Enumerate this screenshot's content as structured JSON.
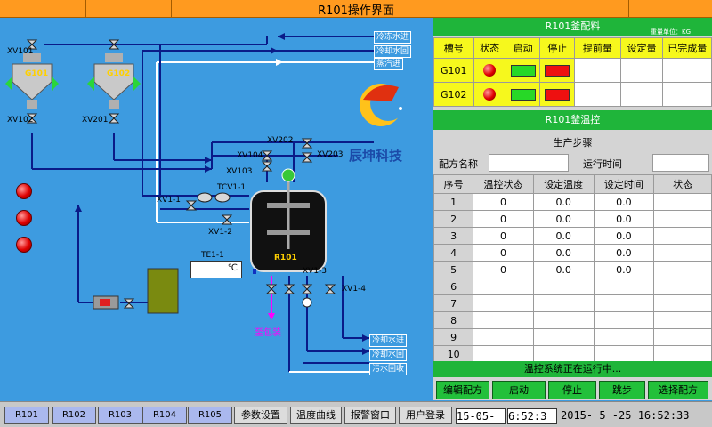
{
  "window": {
    "title": "R101操作界面"
  },
  "schematic": {
    "tanks": [
      {
        "label": "G101"
      },
      {
        "label": "G102"
      }
    ],
    "reactor": {
      "label": "R101"
    },
    "valves": {
      "xv101": "XV101",
      "xv102": "XV102",
      "xv201": "XV201",
      "xv202": "XV202",
      "xv203": "XV203",
      "xv103": "XV103",
      "xv104": "XV104",
      "xv1_1": "XV1-1",
      "xv1_2": "XV1-2",
      "xv1_3": "XV1-3",
      "xv1_4": "XV1-4",
      "tcv1_1": "TCV1-1"
    },
    "inlets": {
      "cold_in_top": "冷冻水进",
      "cold_out_top": "冷却水回",
      "steam_in": "蒸汽进",
      "cool_in_bottom": "冷却水进",
      "cool_out_bottom": "冷却水回",
      "sewage": "污水回收"
    },
    "temp_sensor": {
      "label": "TE1-1",
      "unit": "℃"
    },
    "to_pack": "至包装",
    "logo": {
      "text": "辰坤科技"
    }
  },
  "charging": {
    "title": "R101釜配料",
    "unit_note": "重量单位：KG",
    "headers": [
      "槽号",
      "状态",
      "启动",
      "停止",
      "提前量",
      "设定量",
      "已完成量"
    ],
    "rows": [
      {
        "tank": "G101"
      },
      {
        "tank": "G102"
      }
    ]
  },
  "temp_control": {
    "title": "R101釜温控",
    "steps_title": "生产步骤",
    "recipe_label": "配方名称",
    "runtime_label": "运行时间",
    "headers": [
      "序号",
      "温控状态",
      "设定温度",
      "设定时间",
      "状态"
    ],
    "rows": [
      {
        "no": "1",
        "mode": "0",
        "temp": "0.0",
        "time": "0.0"
      },
      {
        "no": "2",
        "mode": "0",
        "temp": "0.0",
        "time": "0.0"
      },
      {
        "no": "3",
        "mode": "0",
        "temp": "0.0",
        "time": "0.0"
      },
      {
        "no": "4",
        "mode": "0",
        "temp": "0.0",
        "time": "0.0"
      },
      {
        "no": "5",
        "mode": "0",
        "temp": "0.0",
        "time": "0.0"
      },
      {
        "no": "6",
        "mode": "",
        "temp": "",
        "time": ""
      },
      {
        "no": "7",
        "mode": "",
        "temp": "",
        "time": ""
      },
      {
        "no": "8",
        "mode": "",
        "temp": "",
        "time": ""
      },
      {
        "no": "9",
        "mode": "",
        "temp": "",
        "time": ""
      },
      {
        "no": "10",
        "mode": "",
        "temp": "",
        "time": ""
      }
    ],
    "status_text": "温控系统正在运行中...",
    "buttons": {
      "edit": "编辑配方",
      "start": "启动",
      "stop": "停止",
      "jump": "跳步",
      "select": "选择配方"
    }
  },
  "bottom": {
    "nav": [
      "R101",
      "R102",
      "R103",
      "R104",
      "R105"
    ],
    "tools": {
      "params": "参数设置",
      "trend": "温度曲线",
      "alarm": "报警窗口",
      "login": "用户登录"
    },
    "date_short": "15-05-",
    "time_short": "6:52:3",
    "datetime": "2015- 5 -25   16:52:33"
  },
  "colors": {
    "background": "#3d9be0",
    "title_bar": "#ff9a1f",
    "panel_header_yellow": "#f6f81d",
    "panel_header_green": "#1fb53a",
    "pipe": "#0a1b88",
    "magenta_flow": "#ff00ff"
  }
}
